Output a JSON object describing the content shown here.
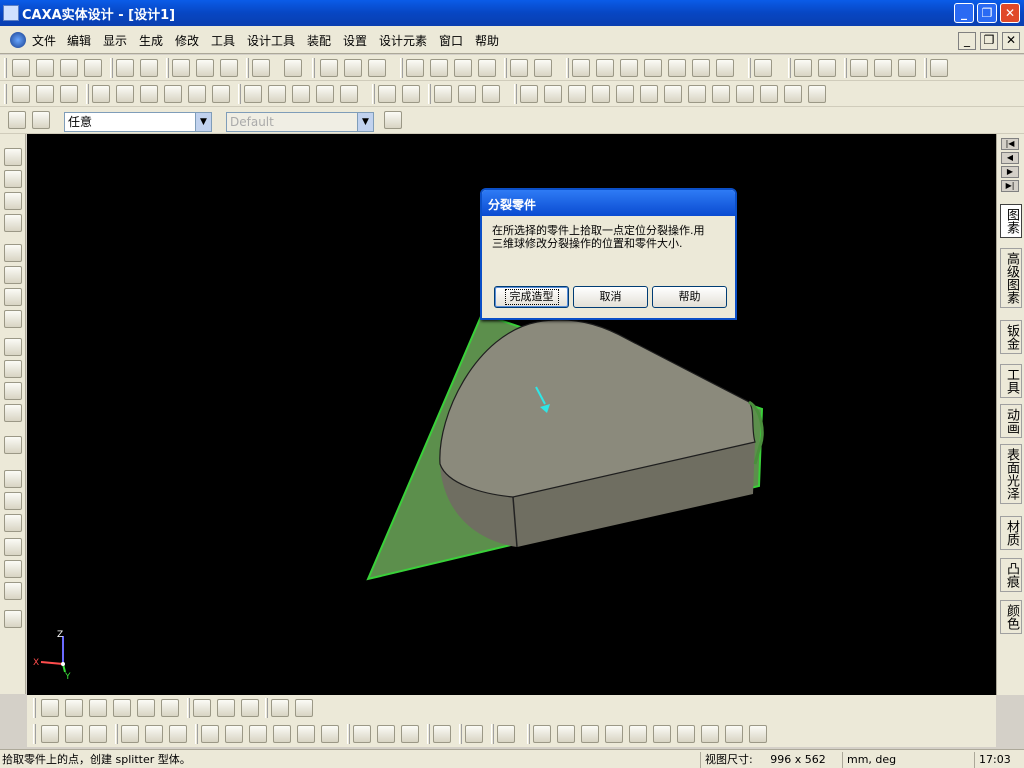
{
  "window": {
    "title": "CAXA实体设计 - [设计1]",
    "controls": {
      "minimize": "_",
      "restore": "❐",
      "close": "✕"
    }
  },
  "menu": {
    "items": [
      "文件",
      "编辑",
      "显示",
      "生成",
      "修改",
      "工具",
      "设计工具",
      "装配",
      "设置",
      "设计元素",
      "窗口",
      "帮助"
    ],
    "doc_controls": {
      "minimize": "_",
      "restore": "❐",
      "close": "✕"
    }
  },
  "selection_toolbar": {
    "filter_value": "任意",
    "style_value": "Default"
  },
  "right_tabs": [
    "图素",
    "高级图素",
    "钣金",
    "工具",
    "动画",
    "表面光泽",
    "材质",
    "凸痕",
    "颜色"
  ],
  "right_nav": [
    "|◀",
    "◀",
    "▶",
    "▶|"
  ],
  "dialog": {
    "title": "分裂零件",
    "message_line1": "在所选择的零件上拾取一点定位分裂操作.用",
    "message_line2": "三维球修改分裂操作的位置和零件大小.",
    "buttons": {
      "finish": "完成造型",
      "cancel": "取消",
      "help": "帮助"
    }
  },
  "axes": {
    "x": "X",
    "y": "Y",
    "z": "Z"
  },
  "status": {
    "message": "拾取零件上的点，创建 splitter 型体。",
    "view_size_label": "视图尺寸:",
    "view_size": "996 x 562",
    "units": "mm, deg",
    "time": "17:03"
  },
  "colors": {
    "titlebar": "#0a4fc7",
    "viewport_bg": "#000000",
    "plane_green": "#5c8f4c",
    "part_gray": "#8b8a7c",
    "arrow_cyan": "#2ee6e6"
  }
}
